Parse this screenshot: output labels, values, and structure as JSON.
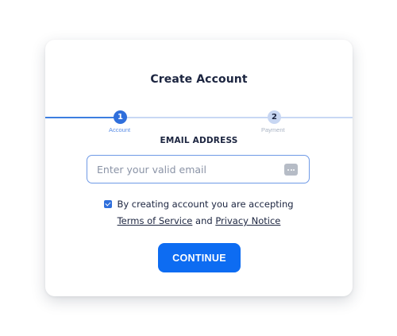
{
  "form": {
    "title": "Create Account",
    "steps": [
      {
        "number": "1",
        "label": "Account",
        "state": "active"
      },
      {
        "number": "2",
        "label": "Payment",
        "state": "pending"
      }
    ],
    "email_heading": "EMAIL ADDRESS",
    "email": {
      "value": "",
      "placeholder": "Enter your valid email",
      "icon": "password-manager-icon"
    },
    "consent": {
      "checked": true,
      "text": "By creating account you are accepting",
      "terms_link": "Terms of Service",
      "connector": "and",
      "privacy_link": "Privacy Notice"
    },
    "continue_label": "CONTINUE"
  },
  "colors": {
    "accent": "#0d6cf2",
    "step_active": "#2f6fdc",
    "step_pending": "#c7d6f2",
    "text": "#1c2540"
  }
}
